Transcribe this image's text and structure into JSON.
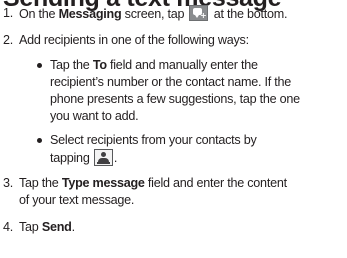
{
  "heading": "Sending a text message",
  "steps": {
    "s1": {
      "num": "1.",
      "pre": "On the ",
      "bold": "Messaging",
      "post": " screen, tap ",
      "after_icon": " at the bottom.",
      "icon": "new-message-icon"
    },
    "s2": {
      "num": "2.",
      "text": "Add recipients in one of the following ways:"
    },
    "b1": {
      "l1_pre": "Tap the ",
      "l1_bold": "To",
      "l1_post": " field and manually enter the",
      "l2": "recipient’s number or the contact name. If the",
      "l3": "phone presents a few suggestions, tap the one",
      "l4": "you want to add."
    },
    "b2": {
      "l1": "Select recipients from your contacts by",
      "l2_pre": "tapping ",
      "l2_post": ".",
      "icon": "contacts-icon"
    },
    "s3": {
      "num": "3.",
      "l1_pre": "Tap the ",
      "l1_bold": "Type message",
      "l1_post": " field and enter the content",
      "l2": "of your text message."
    },
    "s4": {
      "num": "4.",
      "pre": "Tap ",
      "bold": "Send",
      "post": "."
    }
  },
  "colors": {
    "text": "#231f20",
    "icon_gray": "#8a8c8e"
  }
}
